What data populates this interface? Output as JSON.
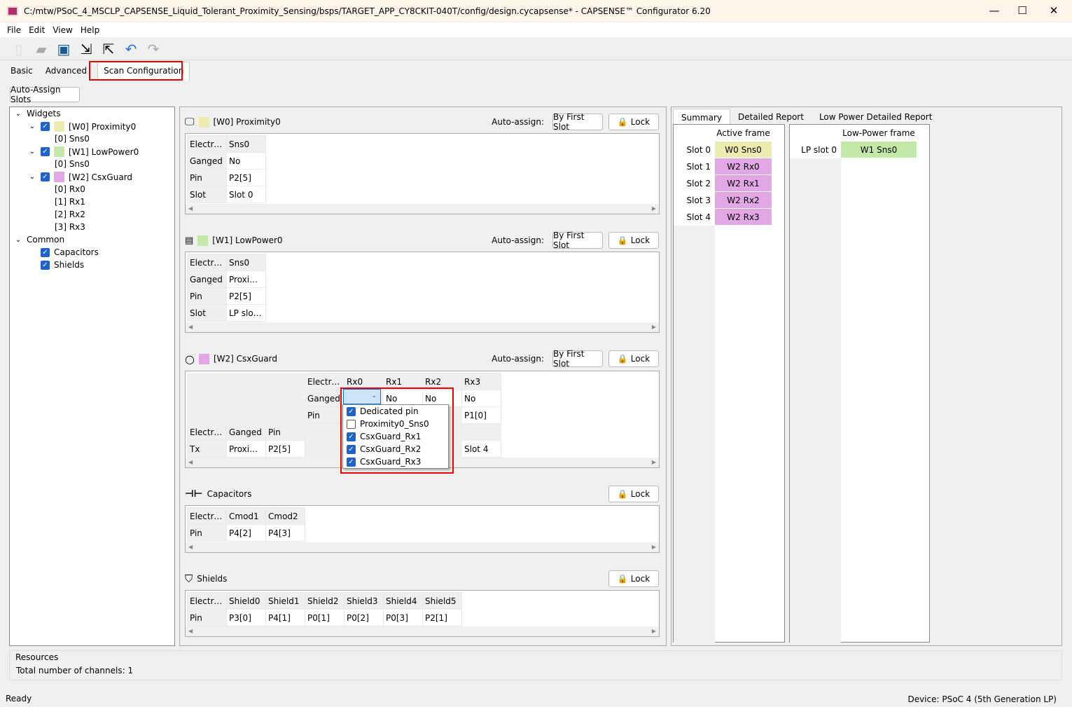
{
  "window": {
    "title": "C:/mtw/PSoC_4_MSCLP_CAPSENSE_Liquid_Tolerant_Proximity_Sensing/bsps/TARGET_APP_CY8CKIT-040T/config/design.cycapsense* - CAPSENSE™ Configurator 6.20",
    "minimize": "—",
    "maximize": "☐",
    "close": "✕"
  },
  "menu": [
    "File",
    "Edit",
    "View",
    "Help"
  ],
  "toolbar": {
    "icons": [
      "new-icon",
      "open-icon",
      "save-icon",
      "import-icon",
      "export-icon",
      "undo-icon",
      "redo-icon"
    ]
  },
  "tabs": [
    {
      "label": "Basic"
    },
    {
      "label": "Advanced"
    },
    {
      "label": "Scan Configuration",
      "active": true
    }
  ],
  "auto_assign_slots": "Auto-Assign Slots",
  "tree": {
    "widgets": "Widgets",
    "w0": {
      "label": "[W0] Proximity0",
      "color": "#ecebb0",
      "children": [
        "[0] Sns0"
      ]
    },
    "w1": {
      "label": "[W1] LowPower0",
      "color": "#c4e8a8",
      "children": [
        "[0] Sns0"
      ]
    },
    "w2": {
      "label": "[W2] CsxGuard",
      "color": "#e2a8e6",
      "children": [
        "[0] Rx0",
        "[1] Rx1",
        "[2] Rx2",
        "[3] Rx3"
      ]
    },
    "common": "Common",
    "capacitors": "Capacitors",
    "shields": "Shields"
  },
  "sections": {
    "auto_assign_label": "Auto-assign:",
    "by_first_slot": "By First Slot",
    "lock": "Lock",
    "w0": {
      "title": "[W0] Proximity0",
      "rows": [
        [
          "Electrode",
          "Sns0"
        ],
        [
          "Ganged",
          "No"
        ],
        [
          "Pin",
          "P2[5]"
        ],
        [
          "Slot",
          "Slot 0"
        ]
      ]
    },
    "w1": {
      "title": "[W1] LowPower0",
      "rows": [
        [
          "Electrode",
          "Sns0"
        ],
        [
          "Ganged",
          "Proxim..."
        ],
        [
          "Pin",
          "P2[5]"
        ],
        [
          "Slot",
          "LP slot 0"
        ]
      ]
    },
    "w2": {
      "title": "[W2] CsxGuard",
      "rows": [
        [
          "",
          "",
          "",
          "Electrode",
          "Rx0",
          "Rx1",
          "Rx2",
          "Rx3"
        ],
        [
          "",
          "",
          "",
          "Ganged",
          "",
          "No",
          "No",
          "No"
        ],
        [
          "",
          "",
          "",
          "Pin",
          "",
          "",
          "",
          "P1[0]"
        ],
        [
          "Electrode",
          "Ganged",
          "Pin",
          "",
          "",
          "",
          "",
          ""
        ],
        [
          "Tx",
          "Proxim...",
          "P2[5]",
          "",
          "",
          "",
          "",
          "Slot 4"
        ]
      ],
      "dropdown_options": [
        {
          "label": "Dedicated pin",
          "checked": true
        },
        {
          "label": "Proximity0_Sns0",
          "checked": false
        },
        {
          "label": "CsxGuard_Rx1",
          "checked": true
        },
        {
          "label": "CsxGuard_Rx2",
          "checked": true
        },
        {
          "label": "CsxGuard_Rx3",
          "checked": true
        }
      ]
    },
    "capacitors": {
      "title": "Capacitors",
      "rows": [
        [
          "Electrode",
          "Cmod1",
          "Cmod2"
        ],
        [
          "Pin",
          "P4[2]",
          "P4[3]"
        ]
      ]
    },
    "shields": {
      "title": "Shields",
      "rows": [
        [
          "Electrode",
          "Shield0",
          "Shield1",
          "Shield2",
          "Shield3",
          "Shield4",
          "Shield5"
        ],
        [
          "Pin",
          "P3[0]",
          "P4[1]",
          "P0[1]",
          "P0[2]",
          "P0[3]",
          "P2[1]"
        ]
      ]
    }
  },
  "report": {
    "tabs": [
      "Summary",
      "Detailed Report",
      "Low Power Detailed Report"
    ],
    "active_frame": {
      "header": "Active frame",
      "slots": [
        {
          "slot": "Slot 0",
          "value": "W0 Sns0",
          "color": "#ecebb0"
        },
        {
          "slot": "Slot 1",
          "value": "W2 Rx0",
          "color": "#e2a8e6"
        },
        {
          "slot": "Slot 2",
          "value": "W2 Rx1",
          "color": "#e2a8e6"
        },
        {
          "slot": "Slot 3",
          "value": "W2 Rx2",
          "color": "#e2a8e6"
        },
        {
          "slot": "Slot 4",
          "value": "W2 Rx3",
          "color": "#e2a8e6"
        }
      ]
    },
    "lp_frame": {
      "header": "Low-Power frame",
      "slots": [
        {
          "slot": "LP slot 0",
          "value": "W1 Sns0",
          "color": "#c4e8a8"
        }
      ]
    }
  },
  "resources": {
    "title": "Resources",
    "channels": "Total number of channels: 1"
  },
  "status": {
    "left": "Ready",
    "right": "Device: PSoC 4 (5th Generation LP)"
  }
}
